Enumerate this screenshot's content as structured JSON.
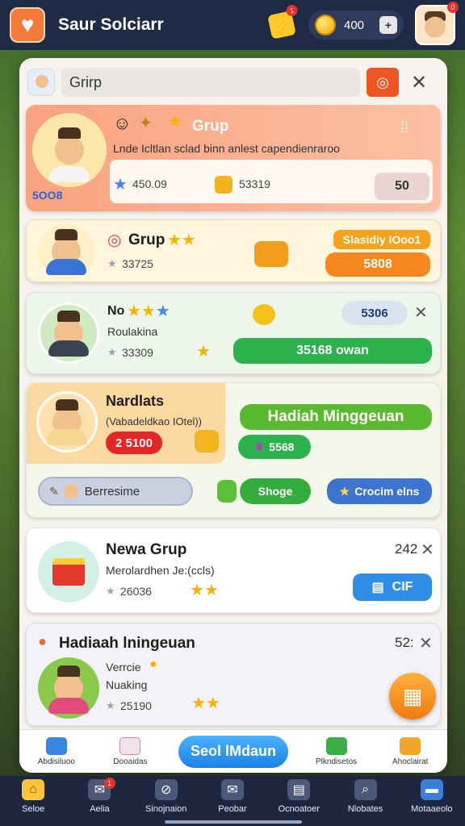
{
  "app": {
    "title": "Saur Solciarr",
    "coins": "400",
    "coin_add": "+",
    "alert_count": "1",
    "profile_badge": "0"
  },
  "search": {
    "value": "Grirp"
  },
  "card1": {
    "title": "Grup",
    "desc": "Lnde Icltlan sclad binn anlest capendienraroo",
    "left_badge": "5OO8",
    "stat1": "450.09",
    "stat2": "53319",
    "btn": "50"
  },
  "card2": {
    "title": "Grup",
    "stat": "33725",
    "banner": "Slasidiy IOoo1",
    "btn": "5808"
  },
  "card3": {
    "title": "No",
    "subtitle": "Roulakina",
    "stat": "33309",
    "pill": "5306",
    "btn": "35168 owan"
  },
  "card4": {
    "title": "Nardlats",
    "subtitle": "(Vabadeldkao IOtel))",
    "red_pill": "2 5100",
    "banner": "Hadiah Minggeuan",
    "gem_pill": "5568",
    "input_placeholder": "Berresime",
    "green_btn": "Shoge",
    "blue_btn": "Crocim elns"
  },
  "card5": {
    "title": "Newa Grup",
    "subtitle": "Merolardhen Je:(ccls)",
    "stat": "26036",
    "count": "242",
    "btn": "CIF"
  },
  "card6": {
    "title": "Hadiaah lningeuan",
    "subtitle1": "Verrcie",
    "subtitle2": "Nuaking",
    "stat": "25190",
    "count": "52:"
  },
  "action_bar": {
    "left1": "Abdisiluoo",
    "left2": "Dooaidas",
    "primary": "Seol lMdaun",
    "right1": "Plkndisetos",
    "right2": "Ahoclairat"
  },
  "nav": {
    "items": [
      {
        "label": "Seloe",
        "icon": "home-icon"
      },
      {
        "label": "Aelia",
        "icon": "mail-icon",
        "badge": "1"
      },
      {
        "label": "Sinojnaion",
        "icon": "compass-icon"
      },
      {
        "label": "Peobar",
        "icon": "envelope-icon"
      },
      {
        "label": "Ocnoatoer",
        "icon": "document-icon"
      },
      {
        "label": "Nlobates",
        "icon": "search-icon"
      },
      {
        "label": "Motaaeolo",
        "icon": "chat-icon"
      }
    ]
  },
  "colors": {
    "accent_orange": "#ef5423",
    "accent_blue": "#1a82e6",
    "accent_green": "#2bb24c"
  }
}
